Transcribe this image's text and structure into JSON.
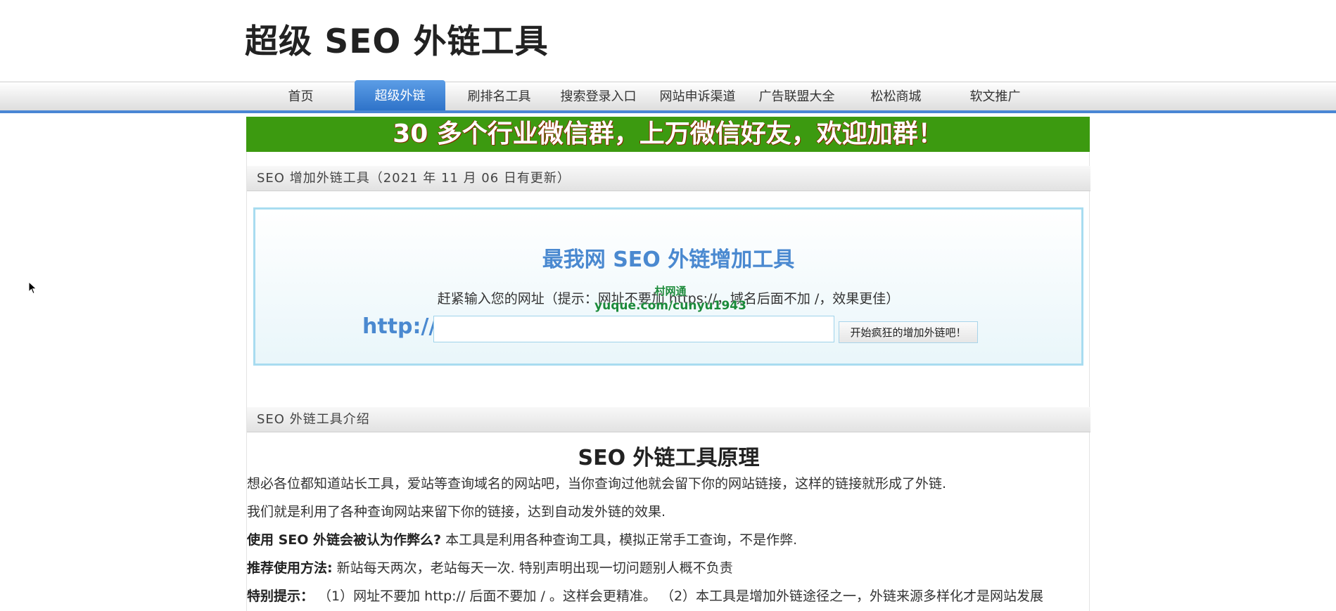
{
  "site": {
    "title": "超级 SEO 外链工具"
  },
  "nav": {
    "items": [
      "首页",
      "超级外链",
      "刷排名工具",
      "搜索登录入口",
      "网站申诉渠道",
      "广告联盟大全",
      "松松商城",
      "软文推广"
    ],
    "active_index": 1
  },
  "banner": {
    "text": "30 多个行业微信群，上万微信好友，欢迎加群！"
  },
  "tool_section": {
    "header": "SEO 增加外链工具（2021 年 11 月 06 日有更新）",
    "title": "最我网 SEO 外链增加工具",
    "hint": "赶紧输入您的网址（提示：网址不要加 https://，域名后面不加 /，效果更佳）",
    "watermark_line1": "村网通",
    "watermark_line2": "yuque.com/cunyu1943",
    "prefix": "http://",
    "input_value": "",
    "button_label": "开始疯狂的增加外链吧！"
  },
  "intro_section": {
    "header": "SEO 外链工具介绍",
    "title": "SEO 外链工具原理",
    "p1": "想必各位都知道站长工具，爱站等查询域名的网站吧，当你查询过他就会留下你的网站链接，这样的链接就形成了外链.",
    "p2": "我们就是利用了各种查询网站来留下你的链接，达到自动发外链的效果.",
    "p3_label": "使用 SEO 外链会被认为作弊么?",
    "p3_text": " 本工具是利用各种查询工具，模拟正常手工查询，不是作弊.",
    "p4_label": "推荐使用方法:",
    "p4_text": " 新站每天两次，老站每天一次. 特别声明出现一切问题别人概不负责",
    "p5_label": "特别提示：",
    "p5_text": "   （1）网址不要加 http:// 后面不要加 / 。这样会更精准。  （2）本工具是增加外链途径之一，外链来源多样化才是网站发展"
  }
}
